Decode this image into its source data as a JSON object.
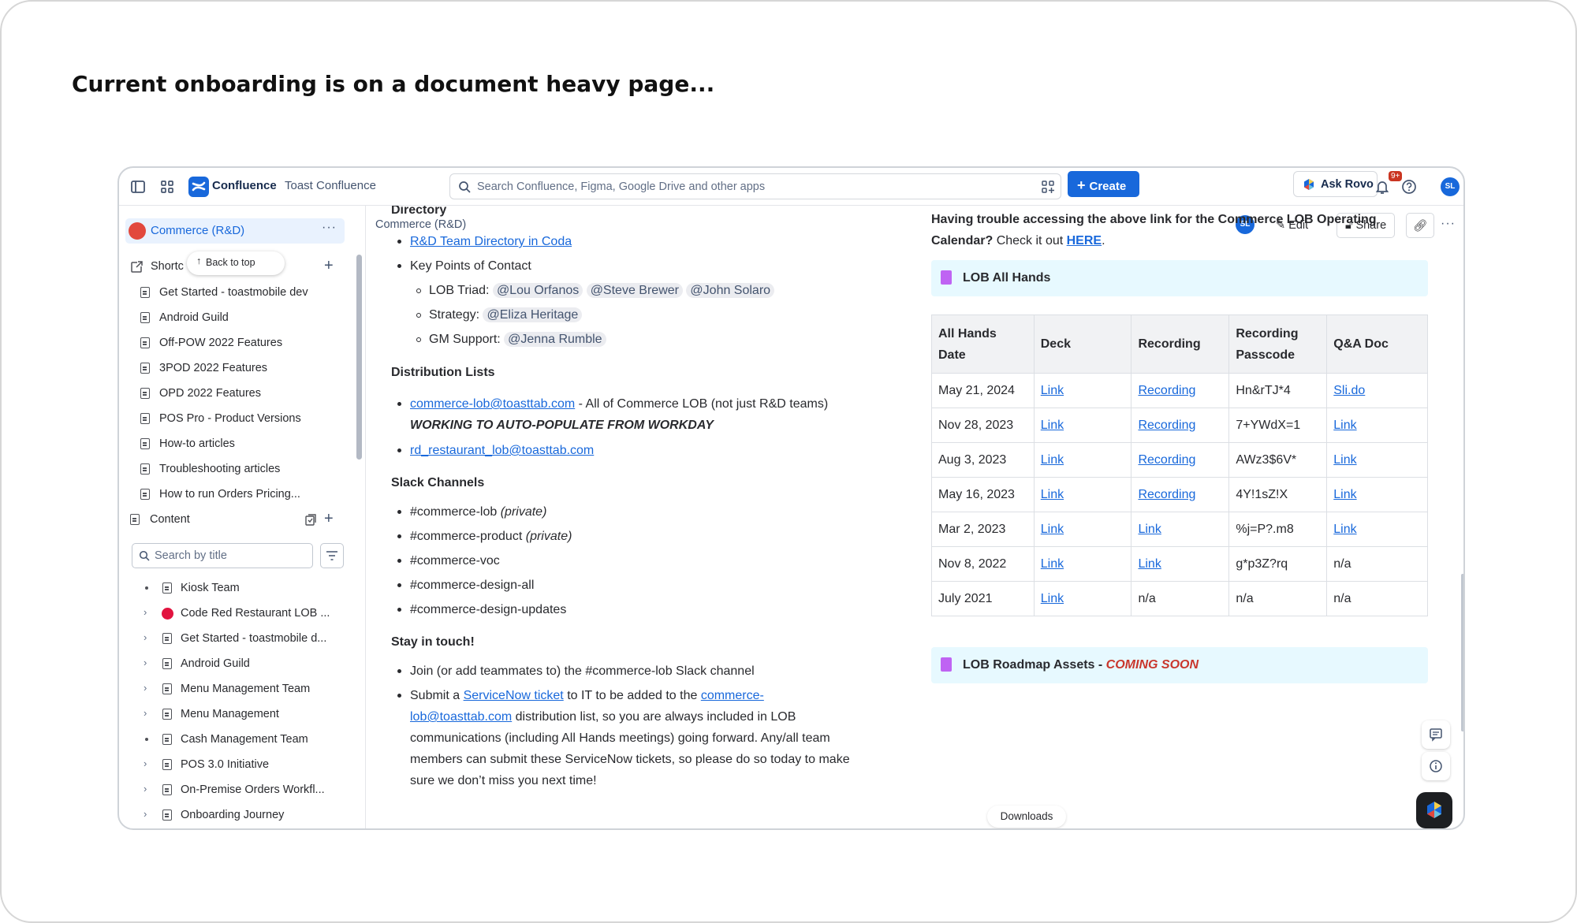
{
  "slide": {
    "title": "Current onboarding is on a document heavy page..."
  },
  "topbar": {
    "brand": "Confluence",
    "space": "Toast Confluence",
    "search_placeholder": "Search Confluence, Figma, Google Drive and other apps",
    "create_label": "Create",
    "ask_rovo_label": "Ask Rovo",
    "notifications_badge": "9+",
    "avatar_initials": "SL"
  },
  "sidebar": {
    "space_title": "Commerce (R&D)",
    "more": "···",
    "shortcuts_label": "Shortc",
    "back_to_top": "Back to top",
    "shortcuts": [
      "Get Started - toastmobile dev",
      "Android Guild",
      "Off-POW 2022 Features",
      "3POD 2022 Features",
      "OPD 2022 Features",
      "POS Pro - Product Versions",
      "How-to articles",
      "Troubleshooting articles",
      "How to run Orders Pricing..."
    ],
    "content_label": "Content",
    "search_placeholder": "Search by title",
    "tree": [
      "Kiosk Team",
      "Code Red Restaurant LOB ...",
      "Get Started - toastmobile d...",
      "Android Guild",
      "Menu Management Team",
      "Menu Management",
      "Cash Management Team",
      "POS 3.0 Initiative",
      "On-Premise Orders Workfl...",
      "Onboarding Journey"
    ]
  },
  "main": {
    "breadcrumb": "Commerce (R&D)",
    "avatar_initials": "SL",
    "edit_label": "Edit",
    "share_label": "Share",
    "more": "···",
    "doc": {
      "directory_heading": "Directory",
      "directory_link": "R&D Team Directory in Coda",
      "key_points": "Key Points of Contact",
      "lob_triad_label": "LOB Triad:",
      "lob_triad": [
        "@Lou Orfanos",
        "@Steve Brewer",
        "@John Solaro"
      ],
      "strategy_label": "Strategy:",
      "strategy": "@Eliza Heritage",
      "gm_label": "GM Support:",
      "gm": "@Jenna Rumble",
      "dist_heading": "Distribution Lists",
      "dist_link1": "commerce-lob@toasttab.com",
      "dist_text1": " - All of Commerce LOB (not just R&D teams)",
      "dist_note": "WORKING TO AUTO-POPULATE FROM WORKDAY",
      "dist_link2": "rd_restaurant_lob@toasttab.com",
      "slack_heading": "Slack Channels",
      "slack": [
        {
          "name": "#commerce-lob",
          "note": "(private)"
        },
        {
          "name": "#commerce-product",
          "note": "(private)"
        },
        {
          "name": "#commerce-voc",
          "note": ""
        },
        {
          "name": "#commerce-design-all",
          "note": ""
        },
        {
          "name": "#commerce-design-updates",
          "note": ""
        }
      ],
      "touch_heading": "Stay in touch!",
      "touch1": "Join (or add teammates to) the #commerce-lob Slack channel",
      "touch2_a": "Submit a ",
      "touch2_link1": "ServiceNow ticket",
      "touch2_b": " to IT to be added to the ",
      "touch2_link2a": "commerce-",
      "touch2_link2b": "lob@toasttab.com",
      "touch2_c": " distribution list, so you are always included in LOB",
      "touch2_d": "communications (including All Hands meetings) going forward. Any/all team",
      "touch2_e": "members can submit these ServiceNow tickets, so please do so today to make",
      "touch2_f": "sure we don’t miss you next time!"
    },
    "right": {
      "trouble_text1": "Having trouble accessing the above link for the Commerce LOB Operating",
      "trouble_text2": "Calendar?",
      "trouble_text3": " Check it out ",
      "trouble_link": "HERE",
      "lob_all_hands": "LOB All Hands",
      "table_headers": [
        "All Hands Date",
        "Deck",
        "Recording",
        "Recording Passcode",
        "Q&A Doc"
      ],
      "table_rows": [
        [
          "May 21, 2024",
          "Link",
          "Recording",
          "Hn&rTJ*4",
          "Sli.do"
        ],
        [
          "Nov 28, 2023",
          "Link",
          "Recording",
          "7+YWdX=1",
          "Link"
        ],
        [
          "Aug 3, 2023",
          "Link",
          "Recording",
          "AWz3$6V*",
          "Link"
        ],
        [
          "May 16, 2023",
          "Link",
          "Recording",
          "4Y!1sZ!X",
          "Link"
        ],
        [
          "Mar 2, 2023",
          "Link",
          "Link",
          "%j=P?.m8",
          "Link"
        ],
        [
          "Nov 8, 2022",
          "Link",
          "Link",
          "g*p3Z?rq",
          "n/a"
        ],
        [
          "July 2021",
          "Link",
          "n/a",
          "n/a",
          "n/a"
        ]
      ],
      "roadmap_title": "LOB Roadmap Assets - ",
      "roadmap_soon": "COMING SOON"
    },
    "downloads": "Downloads"
  },
  "colors": {
    "accent": "#1868db",
    "panel_bg": "#e7f9ff",
    "coming_soon": "#c9372c"
  }
}
